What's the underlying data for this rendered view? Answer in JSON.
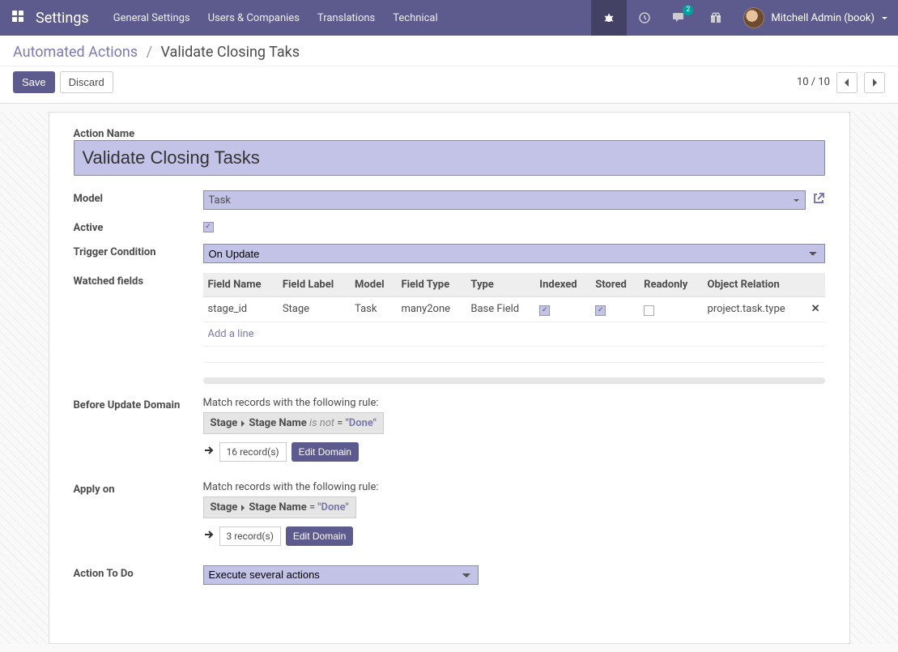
{
  "nav": {
    "brand": "Settings",
    "links": [
      "General Settings",
      "Users & Companies",
      "Translations",
      "Technical"
    ],
    "msg_count": "2",
    "user_label": "Mitchell Admin (book)"
  },
  "breadcrumb": {
    "root": "Automated Actions",
    "current": "Validate Closing Taks"
  },
  "buttons": {
    "save": "Save",
    "discard": "Discard"
  },
  "pager": {
    "text": "10 / 10"
  },
  "form": {
    "labels": {
      "action_name": "Action Name",
      "model": "Model",
      "active": "Active",
      "trigger": "Trigger Condition",
      "watched": "Watched fields",
      "before_domain": "Before Update Domain",
      "apply_on": "Apply on",
      "action_to_do": "Action To Do",
      "add_line": "Add a line"
    },
    "action_name_value": "Validate Closing Tasks",
    "model_value": "Task",
    "trigger_value": "On Update",
    "action_to_do_value": "Execute several actions",
    "table": {
      "cols": [
        "Field Name",
        "Field Label",
        "Model",
        "Field Type",
        "Type",
        "Indexed",
        "Stored",
        "Readonly",
        "Object Relation"
      ],
      "row": {
        "field_name": "stage_id",
        "field_label": "Stage",
        "model": "Task",
        "field_type": "many2one",
        "type": "Base Field",
        "relation": "project.task.type"
      }
    },
    "domain": {
      "match_text": "Match records with the following rule:",
      "path1": "Stage",
      "path2": "Stage Name",
      "isnot": "is not",
      "eq": "=",
      "done": "\"Done\"",
      "rec16": "16 record(s)",
      "rec3": "3 record(s)",
      "edit": "Edit Domain"
    }
  }
}
